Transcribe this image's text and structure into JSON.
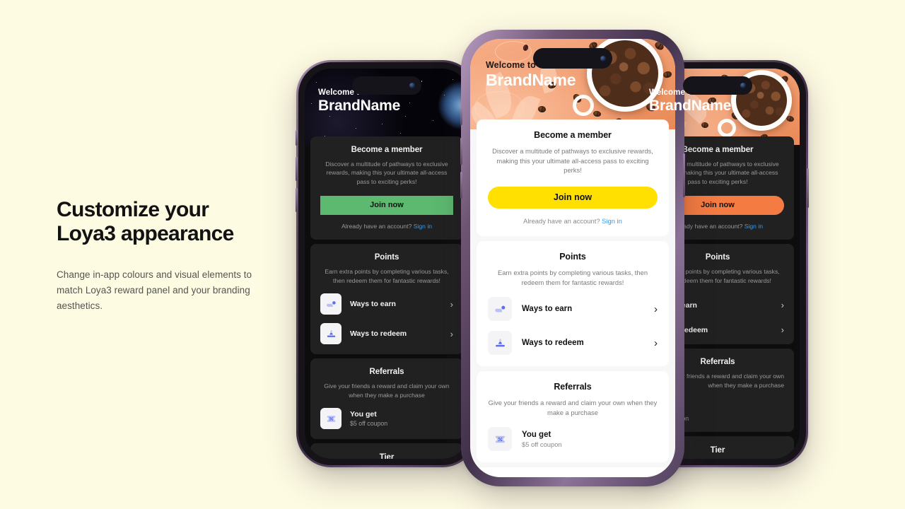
{
  "headline": {
    "line1": "Customize your",
    "line2": "Loya3 appearance",
    "body": "Change in-app colours and visual elements to match Loya3 reward panel and your branding aesthetics."
  },
  "app": {
    "welcome": "Welcome to",
    "brand": "BrandName",
    "member": {
      "title": "Become a member",
      "subtitle": "Discover a multitude of pathways to exclusive rewards, making this your ultimate all-access pass to exciting perks!",
      "cta": "Join now",
      "account_prompt": "Already have an account?",
      "signin": "Sign in"
    },
    "points": {
      "title": "Points",
      "subtitle": "Earn extra points by completing various tasks, then redeem them for fantastic rewards!",
      "rows": [
        {
          "label": "Ways to earn",
          "icon": "earn-hand-icon",
          "chevron": "›"
        },
        {
          "label": "Ways to redeem",
          "icon": "redeem-stamp-icon",
          "chevron": "›"
        }
      ]
    },
    "referrals": {
      "title": "Referrals",
      "subtitle": "Give your friends a reward and claim your own when they make a purchase",
      "reward": {
        "title": "You get",
        "detail": "$5 off coupon",
        "icon": "coupon-percent-icon"
      }
    },
    "tier": {
      "title": "Tier"
    }
  },
  "themes": {
    "left": {
      "name": "space-dark-green",
      "hero": "space-earth-photo",
      "accent": "#5DB96F",
      "accent_text": "#111111",
      "button_radius": "0px",
      "surface": "#212121",
      "page": "#0d0d0d"
    },
    "center": {
      "name": "coffee-light-yellow",
      "hero": "coffee-beans-photo",
      "accent": "#FFE000",
      "accent_text": "#111111",
      "button_radius": "999px",
      "surface": "#ffffff",
      "page": "#f7f7f7"
    },
    "right": {
      "name": "coffee-dark-orange",
      "hero": "coffee-beans-photo",
      "accent": "#F47B42",
      "accent_text": "#111111",
      "button_radius": "999px",
      "surface": "#212121",
      "page": "#0d0d0d"
    }
  },
  "canvas": {
    "background": "#FEFBE3"
  }
}
